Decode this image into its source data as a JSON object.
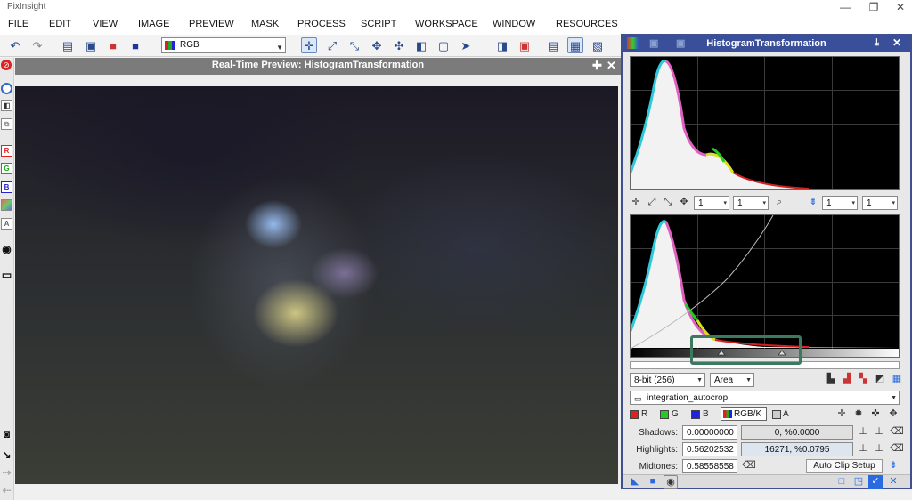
{
  "app": {
    "title": "PixInsight"
  },
  "menu": [
    "FILE",
    "EDIT",
    "VIEW",
    "IMAGE",
    "PREVIEW",
    "MASK",
    "PROCESS",
    "SCRIPT",
    "WORKSPACE",
    "WINDOW",
    "RESOURCES"
  ],
  "toolbar": {
    "channel_select": "RGB"
  },
  "preview": {
    "title": "Real-Time Preview: HistogramTransformation"
  },
  "left_toolbar": {
    "channels": [
      "R",
      "G",
      "B",
      "A"
    ]
  },
  "histogram": {
    "title": "HistogramTransformation",
    "upper_zoom": {
      "h": "1",
      "v": "1"
    },
    "upper_zoom_right": {
      "h": "1",
      "v": "1"
    },
    "resolution": "8-bit (256)",
    "graph_style": "Area",
    "target_view": "integration_autocrop",
    "channels": {
      "r": "R",
      "g": "G",
      "b": "B",
      "rgbk": "RGB/K",
      "a": "A"
    },
    "shadows": {
      "label": "Shadows:",
      "value": "0.00000000",
      "clip": "0, %0.0000"
    },
    "highlights": {
      "label": "Highlights:",
      "value": "0.56202532",
      "clip": "16271, %0.0795"
    },
    "midtones": {
      "label": "Midtones:",
      "value": "0.58558558"
    },
    "auto_clip_label": "Auto Clip Setup",
    "colors": {
      "header": "#3a4f9a",
      "red": "#e02020",
      "green": "#22cc22",
      "blue": "#2222dd",
      "highlight_box": "#3b7a5e"
    }
  }
}
